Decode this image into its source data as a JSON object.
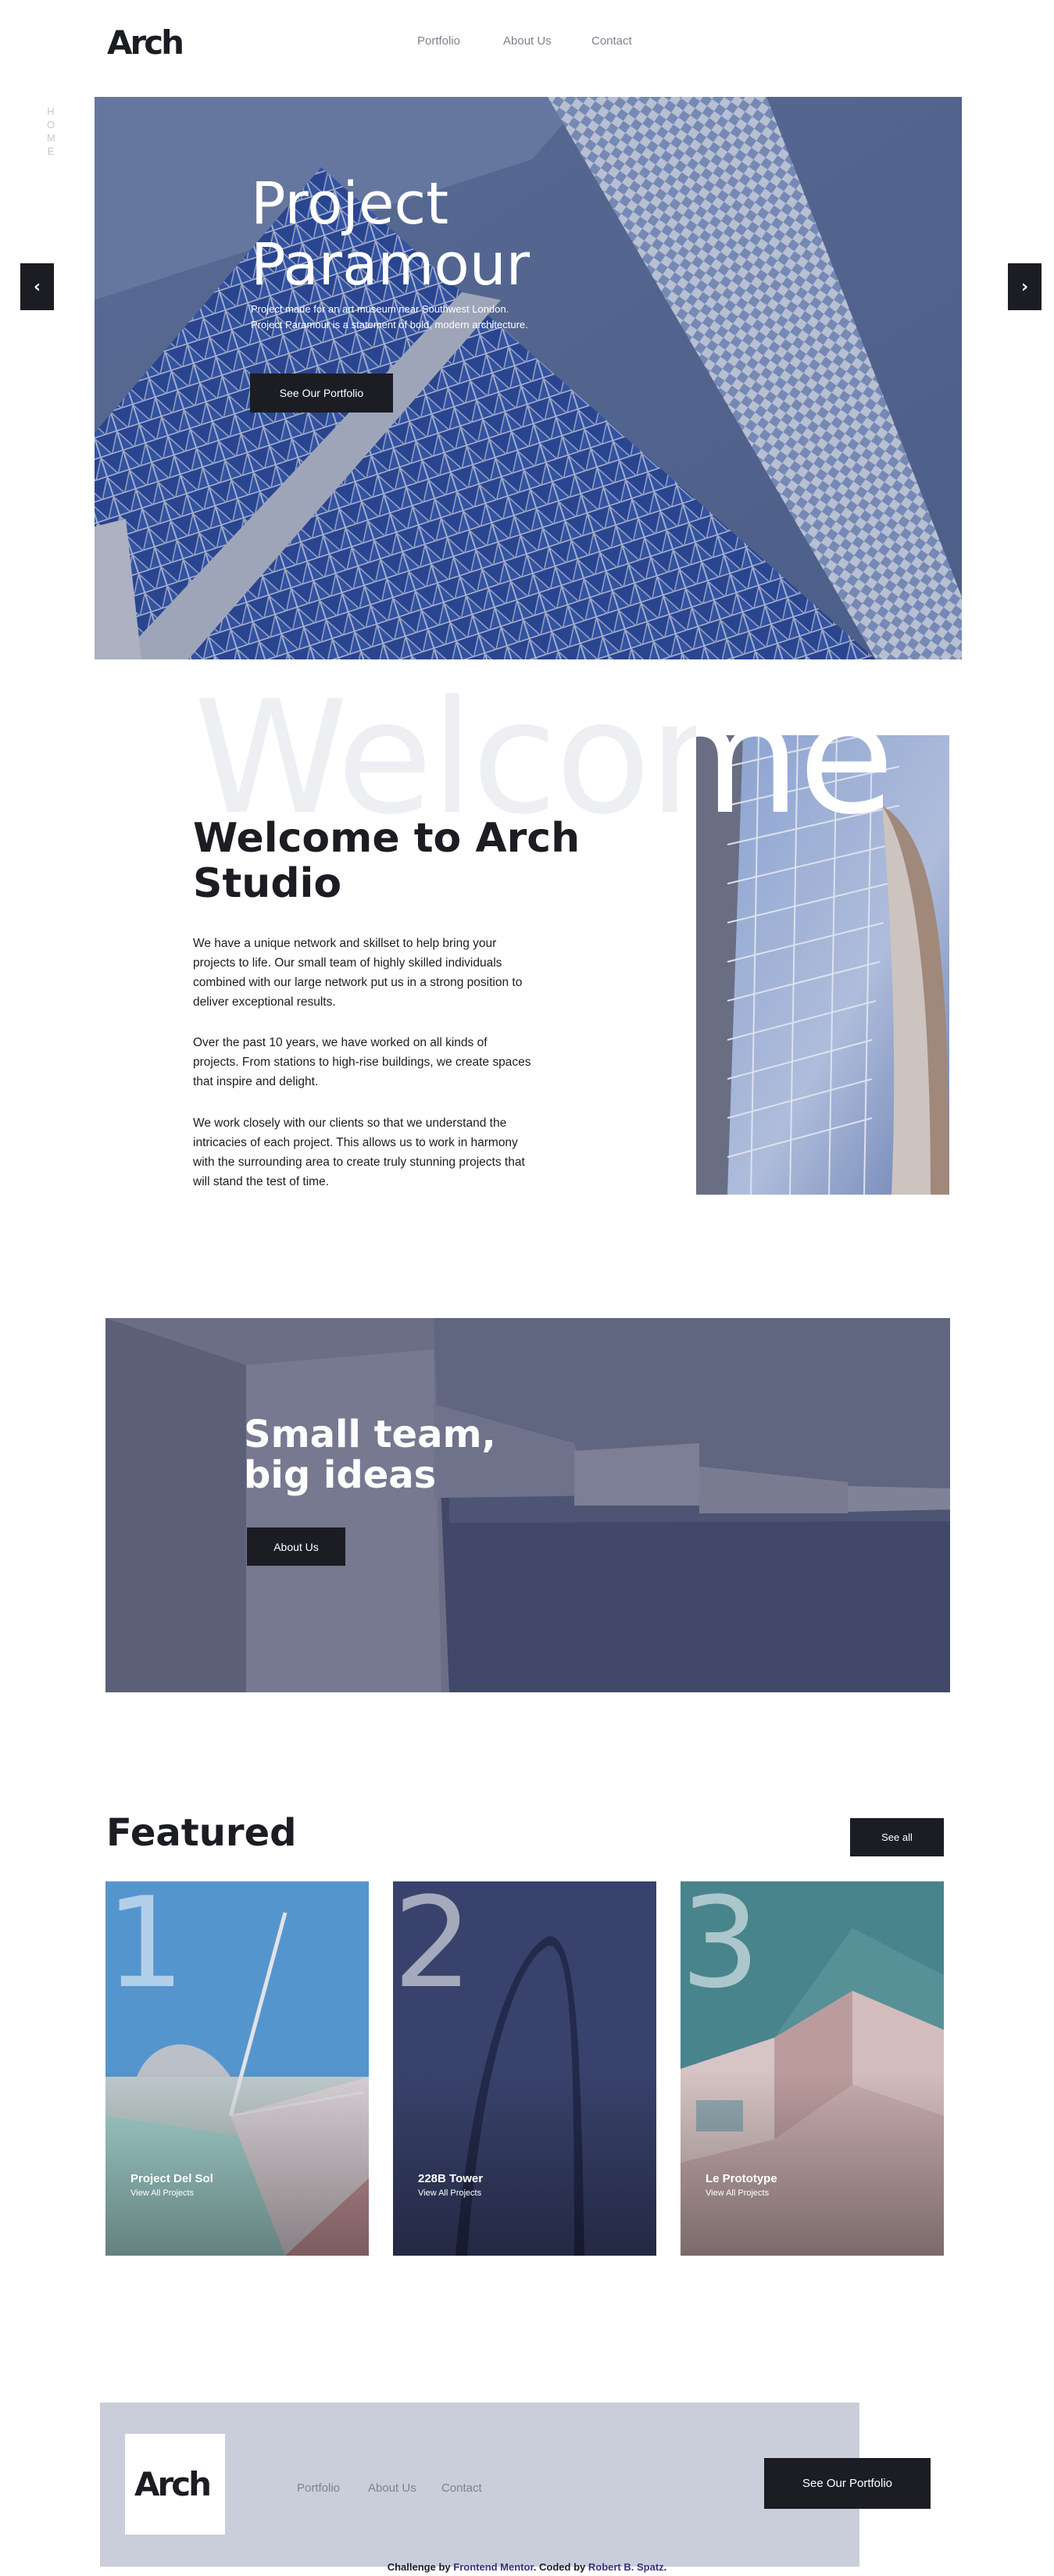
{
  "header": {
    "logo": "Arch",
    "nav": [
      "Portfolio",
      "About Us",
      "Contact"
    ],
    "side_label": "HOME"
  },
  "hero": {
    "title_line1": "Project",
    "title_line2": "Paramour",
    "description_line1": "Project made for an art museum near Southwest London.",
    "description_line2": "Project Paramour is a statement of bold, modern architecture.",
    "cta": "See Our Portfolio",
    "prev_icon": "chevron-left-icon",
    "next_icon": "chevron-right-icon",
    "prev_glyph": "‹",
    "next_glyph": "›"
  },
  "welcome": {
    "background_word": "Welcome",
    "title_line1": "Welcome to Arch",
    "title_line2": "Studio",
    "paragraphs": [
      [
        "We have a unique network and skillset to help bring your",
        "projects to life. Our small team of highly skilled individuals",
        "combined with our large network put us in a strong position to",
        "deliver exceptional results."
      ],
      [
        "Over the past 10 years, we have worked on all kinds of",
        "projects. From stations to high-rise buildings, we create spaces",
        "that inspire and delight."
      ],
      [
        "We work closely with our clients so that we understand the",
        "intricacies of each project. This allows us to work in harmony",
        "with the surrounding area to create truly stunning projects that",
        "will stand the test of time."
      ]
    ]
  },
  "team": {
    "title_line1": "Small team,",
    "title_line2": "big ideas",
    "cta": "About Us"
  },
  "featured": {
    "title": "Featured",
    "see_all": "See all",
    "cards": [
      {
        "number": "1",
        "name": "Project Del Sol",
        "link": "View All Projects"
      },
      {
        "number": "2",
        "name": "228B Tower",
        "link": "View All Projects"
      },
      {
        "number": "3",
        "name": "Le Prototype",
        "link": "View All Projects"
      }
    ]
  },
  "footer": {
    "logo": "Arch",
    "nav": [
      "Portfolio",
      "About Us",
      "Contact"
    ],
    "cta": "See Our Portfolio",
    "attribution": {
      "prefix": "Challenge by ",
      "mentor": "Frontend Mentor",
      "middle": ". Coded by ",
      "author": "Robert B. Spatz",
      "suffix": "."
    }
  },
  "colors": {
    "dark": "#1b1d23",
    "nav_gray": "#7d828f",
    "footer_bg": "#cacdda",
    "welcome_ghost": "#eeeff3"
  }
}
